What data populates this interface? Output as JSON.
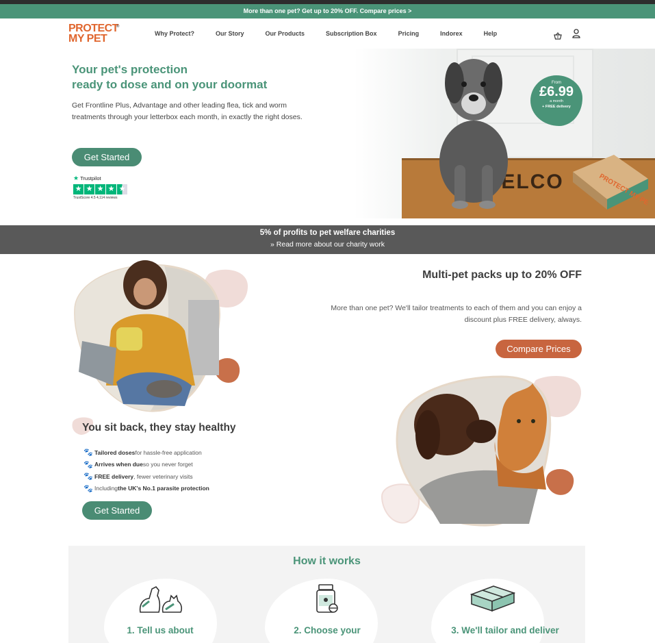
{
  "promo": {
    "text": "More than one pet? Get up to 20% OFF. Compare prices >"
  },
  "header": {
    "logo_line1": "PROTECT",
    "logo_line2": "MY PET",
    "nav": [
      "Why Protect?",
      "Our Story",
      "Our Products",
      "Subscription Box",
      "Pricing",
      "Indorex",
      "Help"
    ],
    "icons": [
      "basket-icon",
      "account-icon"
    ]
  },
  "hero": {
    "title_line1": "Your pet's protection",
    "title_line2": "ready to dose and on your doormat",
    "description": "Get Frontline Plus, Advantage and other leading flea, tick and worm treatments through your letterbox each month, in exactly the right doses.",
    "cta": "Get Started",
    "trustpilot": {
      "brand": "Trustpilot",
      "score_text": "TrustScore 4.5 4,114 reviews",
      "stars": 4.5
    },
    "price_badge": {
      "from": "From",
      "amount": "£6.99",
      "period": "a month",
      "delivery": "+ FREE delivery"
    },
    "mat_text": "WELCO",
    "box_text": "PROTECT MY PET"
  },
  "charity": {
    "headline": "5% of profits to pet welfare charities",
    "link": "Read more about our charity work"
  },
  "multipet": {
    "title": "Multi-pet packs up to 20% OFF",
    "description": "More than one pet? We'll tailor treatments to each of them and you can enjoy a discount plus FREE delivery, always.",
    "cta": "Compare Prices"
  },
  "sitback": {
    "title": "You sit back, they stay healthy",
    "features": [
      {
        "bold": "Tailored doses",
        "rest": " for hassle-free application",
        "prefix": ""
      },
      {
        "bold": "Arrives when due",
        "rest": " so you never forget",
        "prefix": ""
      },
      {
        "bold": "FREE delivery",
        "rest": ", fewer veterinary visits",
        "prefix": ""
      },
      {
        "bold": "the UK's No.1 parasite protection",
        "rest": "",
        "prefix": "Including "
      }
    ],
    "cta": "Get Started"
  },
  "how": {
    "title": "How it works",
    "steps": [
      "1. Tell us about",
      "2. Choose your",
      "3. We'll tailor and deliver"
    ]
  },
  "colors": {
    "brand_green": "#4a9478",
    "brand_orange": "#c8653f",
    "charity_bar": "#595959"
  }
}
